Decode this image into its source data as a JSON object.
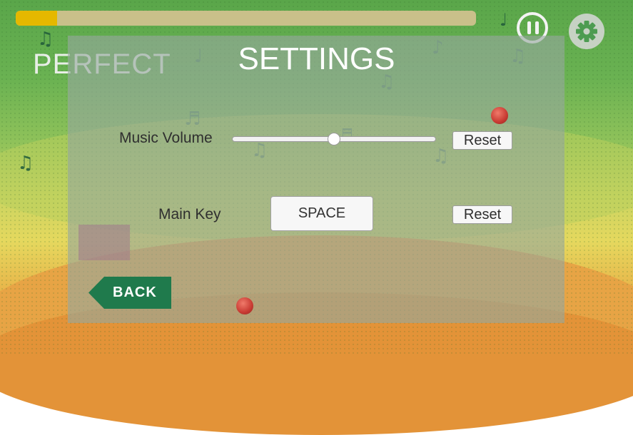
{
  "hud": {
    "progress": 0.09,
    "judgement": "PERFECT",
    "pause_icon": "pause-icon",
    "settings_icon": "gear-icon"
  },
  "settings": {
    "title": "SETTINGS",
    "music_volume": {
      "label": "Music Volume",
      "value": 0.5,
      "reset_label": "Reset"
    },
    "main_key": {
      "label": "Main Key",
      "value": "SPACE",
      "reset_label": "Reset"
    },
    "back_label": "BACK"
  },
  "colors": {
    "progress_fill": "#e5b800",
    "back_button": "#1f7a4c",
    "panel": "#96a89e"
  }
}
